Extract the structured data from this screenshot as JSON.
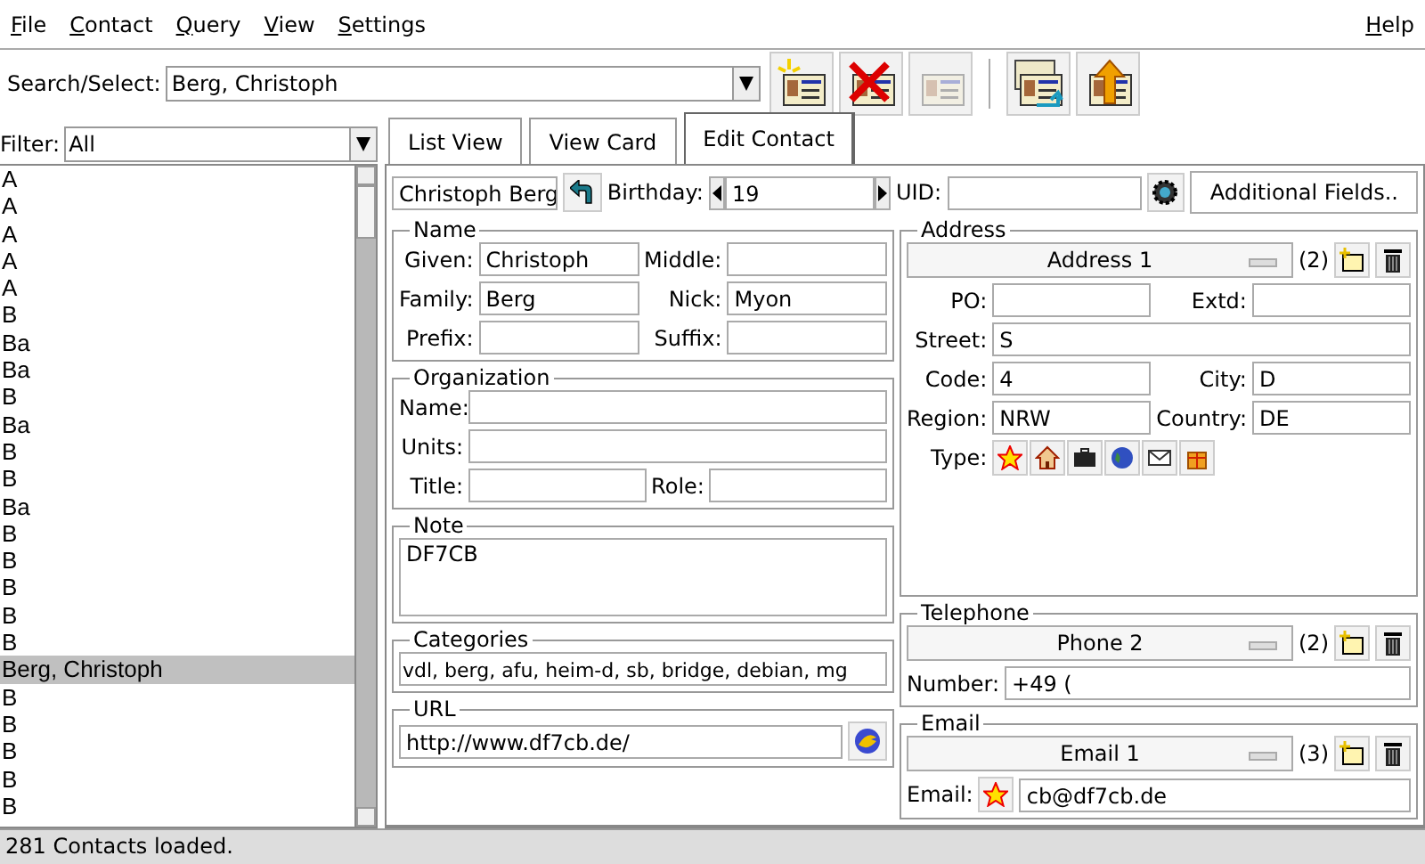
{
  "menu": {
    "items": [
      {
        "label": "File"
      },
      {
        "label": "Contact"
      },
      {
        "label": "Query"
      },
      {
        "label": "View"
      },
      {
        "label": "Settings"
      }
    ],
    "help": "Help"
  },
  "search": {
    "label": "Search/Select:",
    "value": "Berg, Christoph"
  },
  "toolbar": [
    {
      "kind": "new",
      "disabled": false
    },
    {
      "kind": "delete",
      "disabled": false
    },
    {
      "kind": "copy",
      "disabled": true
    },
    {
      "kind": "separator"
    },
    {
      "kind": "cards",
      "disabled": false
    },
    {
      "kind": "export",
      "disabled": false
    }
  ],
  "filter": {
    "label": "Filter:",
    "value": "All"
  },
  "contacts": [
    {
      "name": "A",
      "selected": false
    },
    {
      "name": "A",
      "selected": false
    },
    {
      "name": "A",
      "selected": false
    },
    {
      "name": "A",
      "selected": false
    },
    {
      "name": "A",
      "selected": false
    },
    {
      "name": "B",
      "selected": false
    },
    {
      "name": "Ba",
      "selected": false
    },
    {
      "name": "Ba",
      "selected": false
    },
    {
      "name": "B",
      "selected": false
    },
    {
      "name": "Ba",
      "selected": false
    },
    {
      "name": "B",
      "selected": false
    },
    {
      "name": "B",
      "selected": false
    },
    {
      "name": "Ba",
      "selected": false
    },
    {
      "name": "B",
      "selected": false
    },
    {
      "name": "B",
      "selected": false
    },
    {
      "name": "B",
      "selected": false
    },
    {
      "name": "B",
      "selected": false
    },
    {
      "name": "B",
      "selected": false
    },
    {
      "name": "Berg, Christoph",
      "selected": true
    },
    {
      "name": "B",
      "selected": false
    },
    {
      "name": "B",
      "selected": false
    },
    {
      "name": "B",
      "selected": false
    },
    {
      "name": "B",
      "selected": false
    },
    {
      "name": "B",
      "selected": false
    }
  ],
  "status_bar": "281 Contacts loaded.",
  "tabs": [
    {
      "label": "List View",
      "selected": false
    },
    {
      "label": "View Card",
      "selected": false
    },
    {
      "label": "Edit Contact",
      "selected": true
    }
  ],
  "header": {
    "display_name": "Christoph Berg",
    "birthday_label": "Birthday:",
    "birthday": "19",
    "uid_label": "UID:",
    "additional_button": "Additional Fields.."
  },
  "name": {
    "title": "Name",
    "fields": [
      {
        "label": "Given:",
        "value": "Christoph"
      },
      {
        "label": "Middle:"
      },
      {
        "label": "Family:",
        "value": "Berg"
      },
      {
        "label": "Nick:",
        "value": "Myon"
      },
      {
        "label": "Prefix:"
      },
      {
        "label": "Suffix:"
      }
    ]
  },
  "organization": {
    "title": "Organization",
    "name_label": "Name:",
    "units_label": "Units:",
    "title_label": "Title:",
    "role_label": "Role:"
  },
  "note": {
    "title": "Note",
    "value": "DF7CB"
  },
  "categories": {
    "title": "Categories",
    "value": "vdl, berg, afu, heim-d, sb, bridge, debian, mg"
  },
  "url": {
    "title": "URL",
    "value": "http://www.df7cb.de/"
  },
  "address": {
    "title": "Address",
    "selector": "Address 1",
    "count": "(2)",
    "fields": [
      {
        "label": "PO:"
      },
      {
        "label": "Extd:"
      },
      {
        "label": "Code:",
        "value": "4"
      },
      {
        "label": "City:",
        "value": "D"
      },
      {
        "label": "Region:",
        "value": "NRW"
      },
      {
        "label": "Country:",
        "value": "DE"
      }
    ],
    "street_label": "Street:",
    "street": "S",
    "type_label": "Type:",
    "types": [
      {
        "kind": "star"
      },
      {
        "kind": "home"
      },
      {
        "kind": "work"
      },
      {
        "kind": "globe"
      },
      {
        "kind": "mail"
      },
      {
        "kind": "gift"
      }
    ]
  },
  "telephone": {
    "title": "Telephone",
    "selector": "Phone 2",
    "count": "(2)",
    "number_label": "Number:",
    "number": "+49 ("
  },
  "email": {
    "title": "Email",
    "selector": "Email 1",
    "count": "(3)",
    "email_label": "Email:",
    "email": "cb@df7cb.de"
  }
}
